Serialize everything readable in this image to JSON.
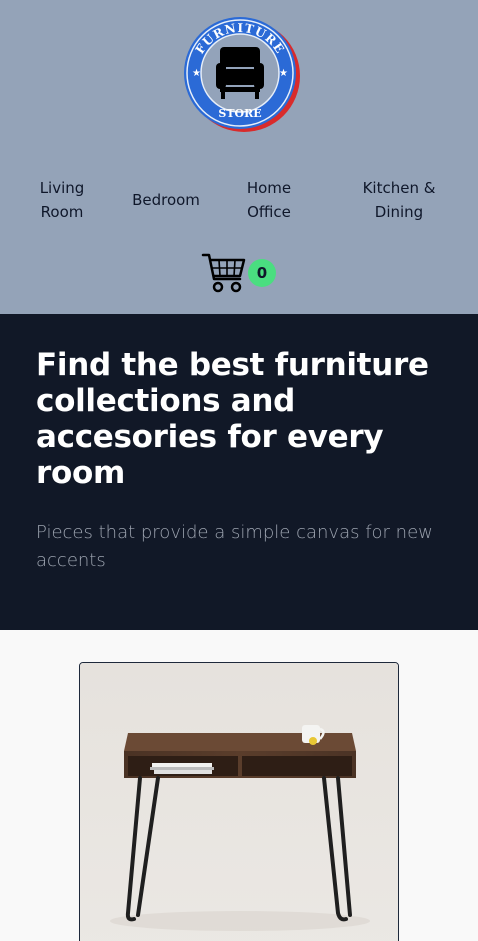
{
  "header": {
    "logo": {
      "top_text": "FURNITURE",
      "bottom_text": "STORE",
      "icon": "armchair-icon"
    },
    "nav": [
      {
        "label_line1": "Living",
        "label_line2": "Room"
      },
      {
        "label_line1": "Bedroom"
      },
      {
        "label_line1": "Home",
        "label_line2": "Office"
      },
      {
        "label_line1": "Kitchen &",
        "label_line2": "Dining"
      }
    ],
    "cart": {
      "icon": "shopping-cart-icon",
      "count": "0"
    },
    "background": "#94a3b8"
  },
  "hero": {
    "title": "Find the best furniture collections and accesories for every room",
    "subtitle": "Pieces that provide a simple canvas for new accents",
    "background": "#111827"
  },
  "product": {
    "image": "desk-with-hairpin-legs"
  },
  "colors": {
    "badge": "#4ade80",
    "logo_ring": "#2b6ad6",
    "logo_outer": "#d92b2b"
  }
}
